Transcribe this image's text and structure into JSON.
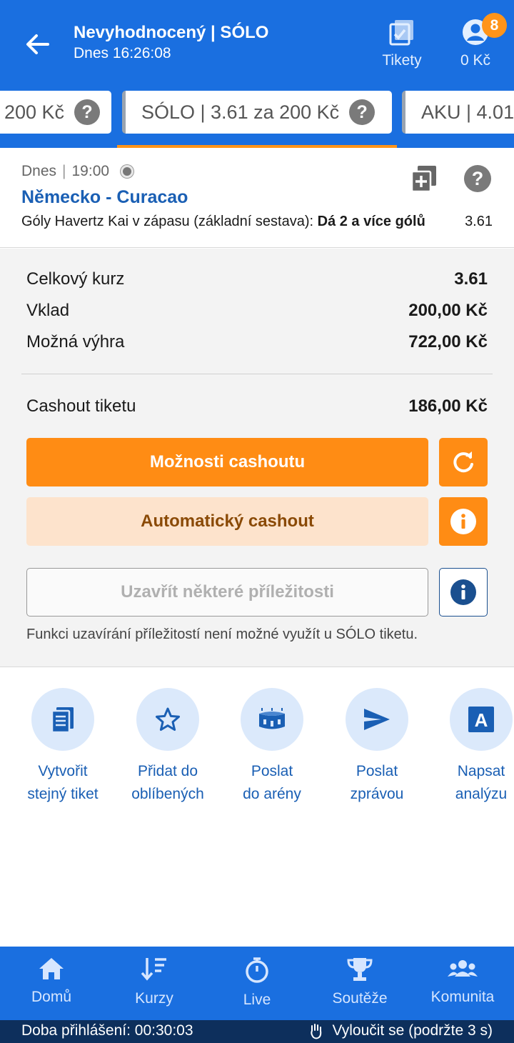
{
  "header": {
    "title": "Nevyhodnocený | SÓLO",
    "subtitle": "Dnes 16:26:08",
    "tickets_label": "Tikety",
    "balance": "0 Kč",
    "badge_count": "8"
  },
  "tabs": [
    {
      "label": "200 Kč"
    },
    {
      "label": "SÓLO  | 3.61 za 200 Kč"
    },
    {
      "label": "AKU  | 4.01"
    }
  ],
  "bet": {
    "day": "Dnes",
    "time": "19:00",
    "match": "Německo - Curacao",
    "market": "Góly Havertz Kai v zápasu (základní sestava):",
    "selection": "Dá 2 a více gólů",
    "odds": "3.61",
    "help_symbol": "?"
  },
  "summary": {
    "total_odds_label": "Celkový kurz",
    "total_odds_value": "3.61",
    "stake_label": "Vklad",
    "stake_value": "200,00 Kč",
    "win_label": "Možná výhra",
    "win_value": "722,00 Kč",
    "cashout_label": "Cashout tiketu",
    "cashout_value": "186,00 Kč",
    "cashout_options_button": "Možnosti cashoutu",
    "auto_cashout_button": "Automatický cashout",
    "close_some_button": "Uzavřít některé příležitosti",
    "note": "Funkci uzavírání příležitostí není možné využít u SÓLO tiketu."
  },
  "actions": [
    {
      "line1": "Vytvořit",
      "line2": "stejný tiket",
      "icon": "ticket-copy-icon"
    },
    {
      "line1": "Přidat do",
      "line2": "oblíbených",
      "icon": "star-icon"
    },
    {
      "line1": "Poslat",
      "line2": "do arény",
      "icon": "arena-icon"
    },
    {
      "line1": "Poslat",
      "line2": "zprávou",
      "icon": "send-icon"
    },
    {
      "line1": "Napsat",
      "line2": "analýzu",
      "icon": "analysis-icon"
    }
  ],
  "nav": [
    {
      "label": "Domů",
      "icon": "home-icon"
    },
    {
      "label": "Kurzy",
      "icon": "odds-icon"
    },
    {
      "label": "Live",
      "icon": "stopwatch-icon"
    },
    {
      "label": "Soutěže",
      "icon": "trophy-icon"
    },
    {
      "label": "Komunita",
      "icon": "community-icon"
    }
  ],
  "status": {
    "session": "Doba přihlášení: 00:30:03",
    "exclude": "Vyloučit se (podržte 3 s)"
  },
  "colors": {
    "primary": "#1a6fe0",
    "accent": "#ff8c14",
    "link": "#1a5fb4",
    "status_bar": "#0d2f5c"
  }
}
